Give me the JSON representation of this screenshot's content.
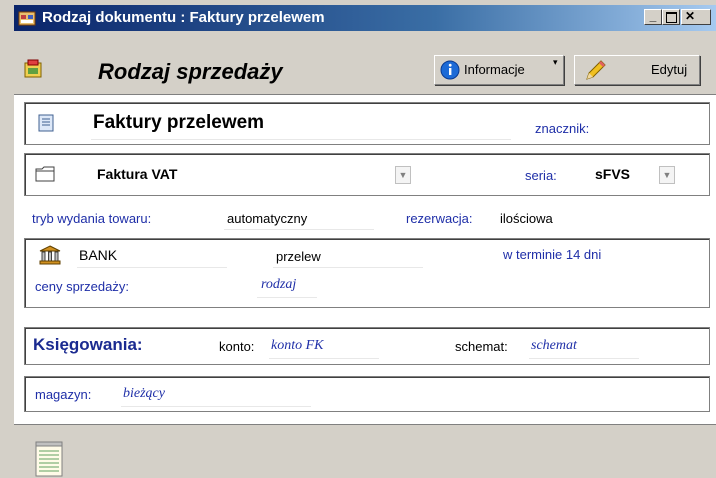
{
  "window": {
    "title": "Rodzaj dokumentu : Faktury przelewem",
    "controls": [
      "minimize",
      "maximize",
      "close"
    ]
  },
  "toolbar": {
    "title": "Rodzaj sprzedaży",
    "info_label": "Informacje",
    "edit_label": "Edytuj"
  },
  "doc_type": {
    "name": "Faktury przelewem",
    "tag_label": "znacznik:"
  },
  "invoice": {
    "type": "Faktura VAT",
    "series_label": "seria:",
    "series_value": "sFVS"
  },
  "settings": {
    "issue_label": "tryb wydania towaru:",
    "issue_value": "automatyczny",
    "reservation_label": "rezerwacja:",
    "reservation_value": "ilościowa"
  },
  "payment": {
    "bank": "BANK",
    "method": "przelew",
    "terms": "w terminie 14 dni",
    "prices_label": "ceny sprzedaży:",
    "prices_value": "rodzaj"
  },
  "accounting": {
    "heading": "Księgowania:",
    "account_label": "konto:",
    "account_value": "konto FK",
    "scheme_label": "schemat:",
    "scheme_value": "schemat"
  },
  "warehouse": {
    "label": "magazyn:",
    "value": "bieżący"
  },
  "colors": {
    "title_bar": "#0a246a",
    "accent_blue": "#1f2fa8",
    "window_bg": "#d4d0c8"
  }
}
